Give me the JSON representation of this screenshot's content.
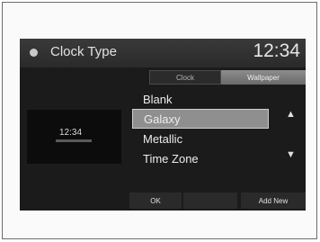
{
  "screen": {
    "title": "Clock Type",
    "clock": "12:34"
  },
  "tabs": [
    {
      "label": "Clock",
      "active": false
    },
    {
      "label": "Wallpaper",
      "active": true
    }
  ],
  "preview": {
    "time": "12:34"
  },
  "list": {
    "items": [
      "Blank",
      "Galaxy",
      "Metallic",
      "Time Zone"
    ],
    "selected": "Galaxy"
  },
  "icons": {
    "back": "back-icon",
    "up": "chevron-up-icon",
    "down": "chevron-down-icon"
  },
  "bottom_buttons": {
    "ok": "OK",
    "add_new": "Add New"
  },
  "colors": {
    "screen_bg": "#1b1b1b",
    "selected_bg": "#8f8f8f",
    "active_tab_bg": "#7a7a7a"
  }
}
